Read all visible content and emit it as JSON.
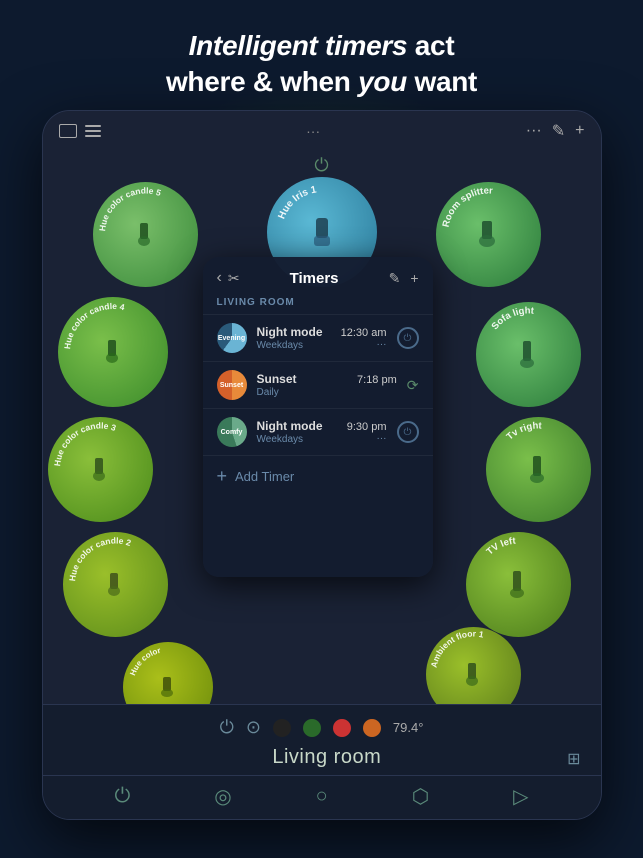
{
  "page": {
    "heading": {
      "line1_bold": "Intelligent timers",
      "line1_rest": " act",
      "line2": "where & when ",
      "line2_bold": "you",
      "line2_rest": " want"
    },
    "topbar": {
      "dots": "···",
      "edit_icon": "✎",
      "plus_icon": "+"
    },
    "circles": [
      {
        "id": "iris",
        "label": "Hue Iris 1",
        "color_start": "#5ab8d4",
        "color_end": "#2a7a9a"
      },
      {
        "id": "room-splitter",
        "label": "Room splitter",
        "color_start": "#6abf6a",
        "color_end": "#2a7a3a"
      },
      {
        "id": "sofa",
        "label": "Sofa light",
        "color_start": "#6abf6a",
        "color_end": "#2a7a3a"
      },
      {
        "id": "tv-right",
        "label": "Tv right",
        "color_start": "#7abf4a",
        "color_end": "#3a7a2a"
      },
      {
        "id": "tv-left",
        "label": "TV left",
        "color_start": "#8abf3a",
        "color_end": "#4a7a1a"
      },
      {
        "id": "floor",
        "label": "Ambient floor 1",
        "color_start": "#9abf2a",
        "color_end": "#5a7a1a"
      },
      {
        "id": "hue5",
        "label": "Hue color candle 5",
        "color_start": "#7abf6a",
        "color_end": "#3a8a3a"
      },
      {
        "id": "hue4",
        "label": "Hue color candle 4",
        "color_start": "#7abf4a",
        "color_end": "#3a8a2a"
      },
      {
        "id": "hue3",
        "label": "Hue color candle 3",
        "color_start": "#8abf3a",
        "color_end": "#4a8a1a"
      },
      {
        "id": "hue2",
        "label": "Hue color candle 2",
        "color_start": "#9abf2a",
        "color_end": "#5a8a1a"
      },
      {
        "id": "hue-bottom",
        "label": "Hue color",
        "color_start": "#aabf1a",
        "color_end": "#6a8a0a"
      }
    ],
    "timers_panel": {
      "back_label": "‹",
      "title": "Timers",
      "edit_icon": "✎",
      "add_icon": "+",
      "section_label": "LIVING ROOM",
      "timers": [
        {
          "id": "evening",
          "avatar_label": "Evening",
          "name": "Night mode",
          "frequency": "Weekdays",
          "time": "12:30 am",
          "status_dots": "···",
          "toggle": "power",
          "toggle_on": false
        },
        {
          "id": "sunset",
          "avatar_label": "Sunset",
          "name": "Sunset",
          "frequency": "Daily",
          "time": "7:18 pm",
          "status_dots": "",
          "toggle": "sync",
          "toggle_on": true
        },
        {
          "id": "comfy",
          "avatar_label": "Comfy",
          "name": "Night mode",
          "frequency": "Weekdays",
          "time": "9:30 pm",
          "status_dots": "···",
          "toggle": "power",
          "toggle_on": false
        }
      ],
      "add_timer_label": "Add Timer"
    },
    "bottom": {
      "room_name": "Living room",
      "temperature": "79.4°",
      "colors": [
        "#333333",
        "#2a5a2a",
        "#cc3333",
        "#cc6622"
      ],
      "nav_icons": [
        "⏻",
        "◎",
        "○",
        "⬡",
        "▷"
      ]
    }
  }
}
